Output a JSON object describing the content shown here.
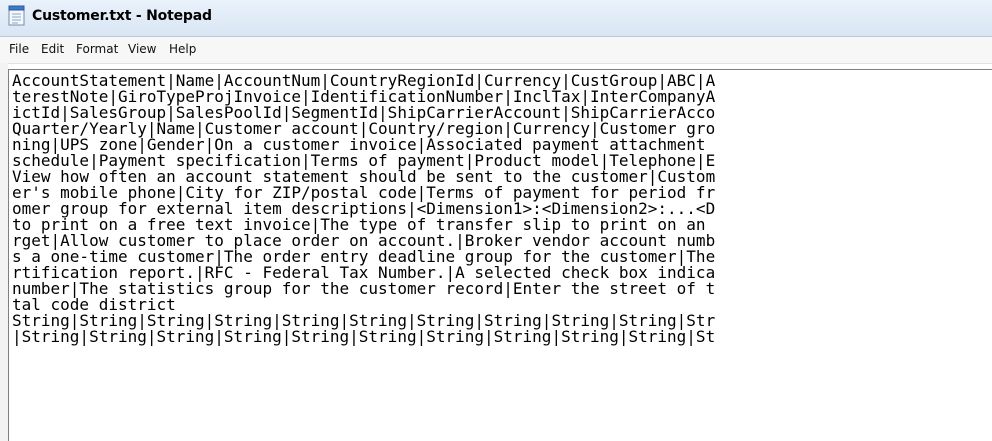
{
  "window": {
    "title": "Customer.txt - Notepad",
    "icon": "notepad-icon"
  },
  "menu": {
    "file": "File",
    "edit": "Edit",
    "format": "Format",
    "view": "View",
    "help": "Help"
  },
  "editor": {
    "lines": [
      "AccountStatement|Name|AccountNum|CountryRegionId|Currency|CustGroup|ABC|A",
      "terestNote|GiroTypeProjInvoice|IdentificationNumber|InclTax|InterCompanyA",
      "ictId|SalesGroup|SalesPoolId|SegmentId|ShipCarrierAccount|ShipCarrierAcco",
      "Quarter/Yearly|Name|Customer account|Country/region|Currency|Customer gro",
      "ning|UPS zone|Gender|On a customer invoice|Associated payment attachment",
      "schedule|Payment specification|Terms of payment|Product model|Telephone|E",
      "View how often an account statement should be sent to the customer|Custom",
      "er's mobile phone|City for ZIP/postal code|Terms of payment for period fr",
      "omer group for external item descriptions|<Dimension1>:<Dimension2>:...<D",
      "to print on a free text invoice|The type of transfer slip to print on an",
      "rget|Allow customer to place order on account.|Broker vendor account numb",
      "s a one-time customer|The order entry deadline group for the customer|The",
      "rtification report.|RFC - Federal Tax Number.|A selected check box indica",
      "number|The statistics group for the customer record|Enter the street of t",
      "tal code district",
      "String|String|String|String|String|String|String|String|String|String|Str",
      "|String|String|String|String|String|String|String|String|String|String|St"
    ]
  }
}
